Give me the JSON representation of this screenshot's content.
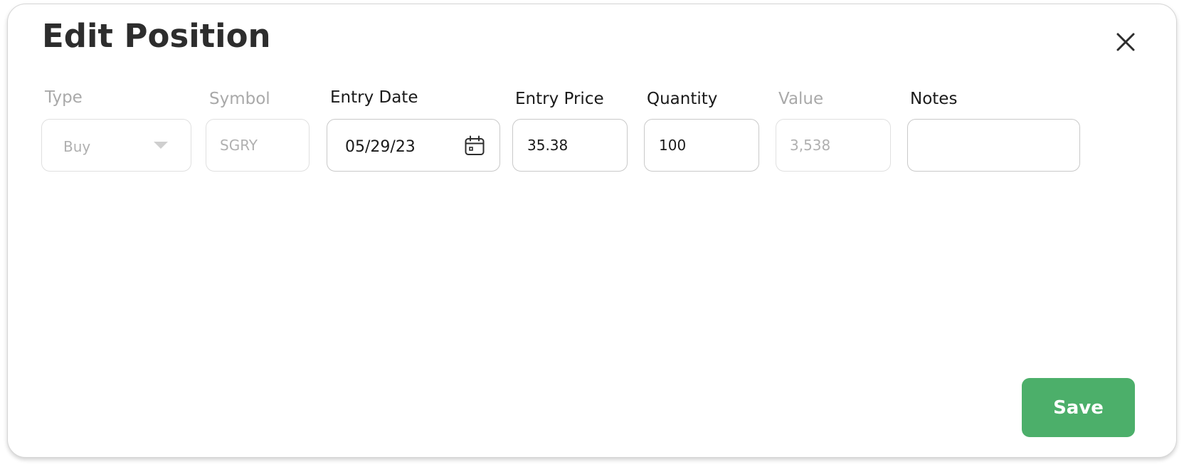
{
  "dialog": {
    "title": "Edit Position",
    "close_icon": "close-icon"
  },
  "fields": {
    "type": {
      "label": "Type",
      "value": "Buy",
      "disabled": true,
      "icon": "caret-down-icon"
    },
    "symbol": {
      "label": "Symbol",
      "value": "SGRY",
      "disabled": true
    },
    "entry_date": {
      "label": "Entry Date",
      "value": "05/29/23",
      "icon": "calendar-icon"
    },
    "entry_price": {
      "label": "Entry Price",
      "value": "35.38"
    },
    "quantity": {
      "label": "Quantity",
      "value": "100"
    },
    "value": {
      "label": "Value",
      "value": "3,538",
      "disabled": true
    },
    "notes": {
      "label": "Notes",
      "value": ""
    }
  },
  "actions": {
    "save_label": "Save"
  },
  "colors": {
    "save_button": "#4caf6a",
    "title_text": "#2d2d2d",
    "disabled_text": "#a9a9a9",
    "field_border": "#c9c9c9"
  }
}
